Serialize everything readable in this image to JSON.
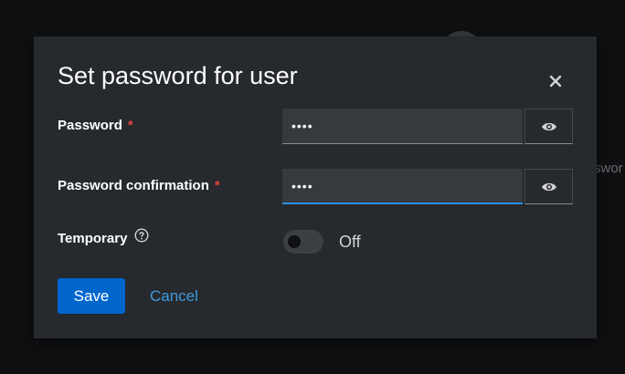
{
  "background": {
    "partial_text": "swor"
  },
  "dialog": {
    "title": "Set password for user",
    "close_icon": "close-icon"
  },
  "password": {
    "label": "Password",
    "required_mark": "*",
    "value": "••••",
    "toggle_icon": "eye-icon"
  },
  "confirmation": {
    "label": "Password confirmation",
    "required_mark": "*",
    "value": "••••",
    "toggle_icon": "eye-icon"
  },
  "temporary": {
    "label": "Temporary",
    "help_icon": "help-icon",
    "state": "Off",
    "enabled": false
  },
  "actions": {
    "save_label": "Save",
    "cancel_label": "Cancel"
  },
  "colors": {
    "primary": "#0066cc",
    "link": "#3d9be0",
    "required": "#e0463f",
    "focus": "#2b8fe0",
    "dialog_bg": "#26292d"
  }
}
